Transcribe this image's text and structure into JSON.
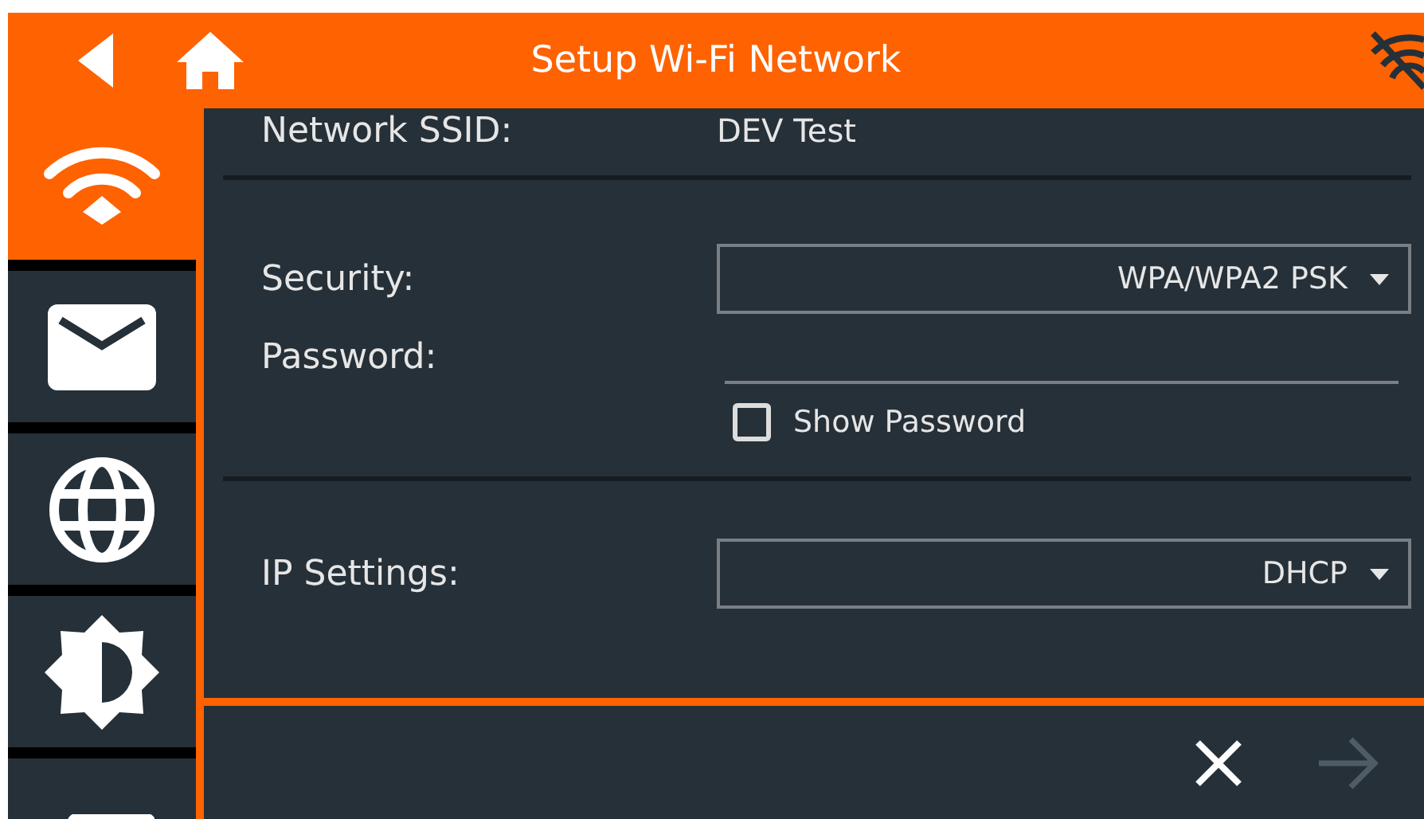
{
  "header": {
    "title": "Setup Wi-Fi Network"
  },
  "sidebar": {
    "items": [
      {
        "kind": "wifi",
        "selected": true
      },
      {
        "kind": "mail",
        "selected": false
      },
      {
        "kind": "globe",
        "selected": false
      },
      {
        "kind": "brightness",
        "selected": false
      },
      {
        "kind": "device",
        "selected": false
      }
    ]
  },
  "form": {
    "ssid": {
      "label": "Network SSID:",
      "value": "DEV Test"
    },
    "security": {
      "label": "Security:",
      "value": "WPA/WPA2 PSK"
    },
    "password": {
      "label": "Password:"
    },
    "show_password": {
      "label": "Show Password",
      "checked": false
    },
    "ip_settings": {
      "label": "IP Settings:",
      "value": "DHCP"
    }
  },
  "footer": {
    "cancel": {
      "disabled": false
    },
    "next": {
      "disabled": true
    }
  }
}
